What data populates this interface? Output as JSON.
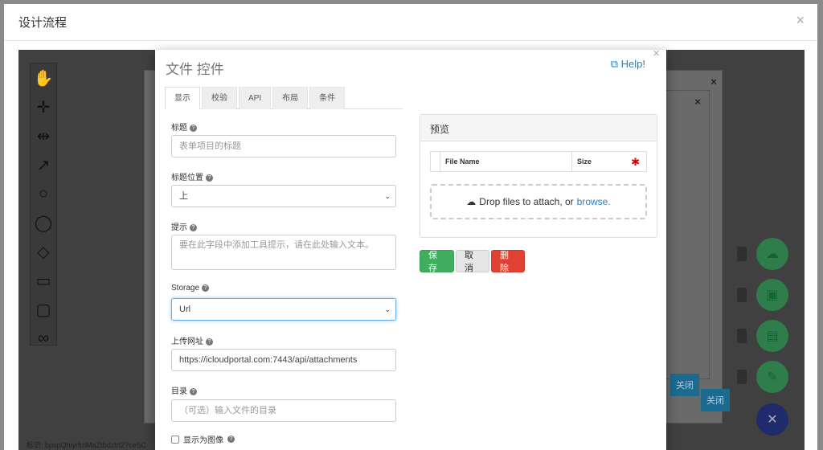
{
  "outer": {
    "title": "设计流程",
    "close": "×"
  },
  "canvas": {
    "process_id": "标识: bpspQhiyrfmMaZtbdztrf2?ceSC"
  },
  "ghost": {
    "close1": "×",
    "close2": "×",
    "close_btn": "关闭",
    "close_btn2": "关闭"
  },
  "dialog": {
    "title": "文件 控件",
    "help": "Help!",
    "close": "×",
    "tabs": [
      "显示",
      "校验",
      "API",
      "布局",
      "条件"
    ],
    "fields": {
      "label_title": "标题",
      "title_placeholder": "表单项目的标题",
      "label_position": "标题位置",
      "position_value": "上",
      "label_tooltip": "提示",
      "tooltip_placeholder": "要在此字段中添加工具提示，请在此处输入文本。",
      "label_storage": "Storage",
      "storage_value": "Url",
      "label_url": "上传网址",
      "url_value": "https://icloudportal.com:7443/api/attachments",
      "label_dir": "目录",
      "dir_placeholder": "（可选）输入文件的目录",
      "label_image": "显示为图像"
    },
    "preview": {
      "heading": "预览",
      "col_name": "File Name",
      "col_size": "Size",
      "drop_text": "Drop files to attach, or",
      "browse": "browse."
    },
    "buttons": {
      "save": "保存",
      "cancel": "取消",
      "delete": "删除"
    }
  }
}
